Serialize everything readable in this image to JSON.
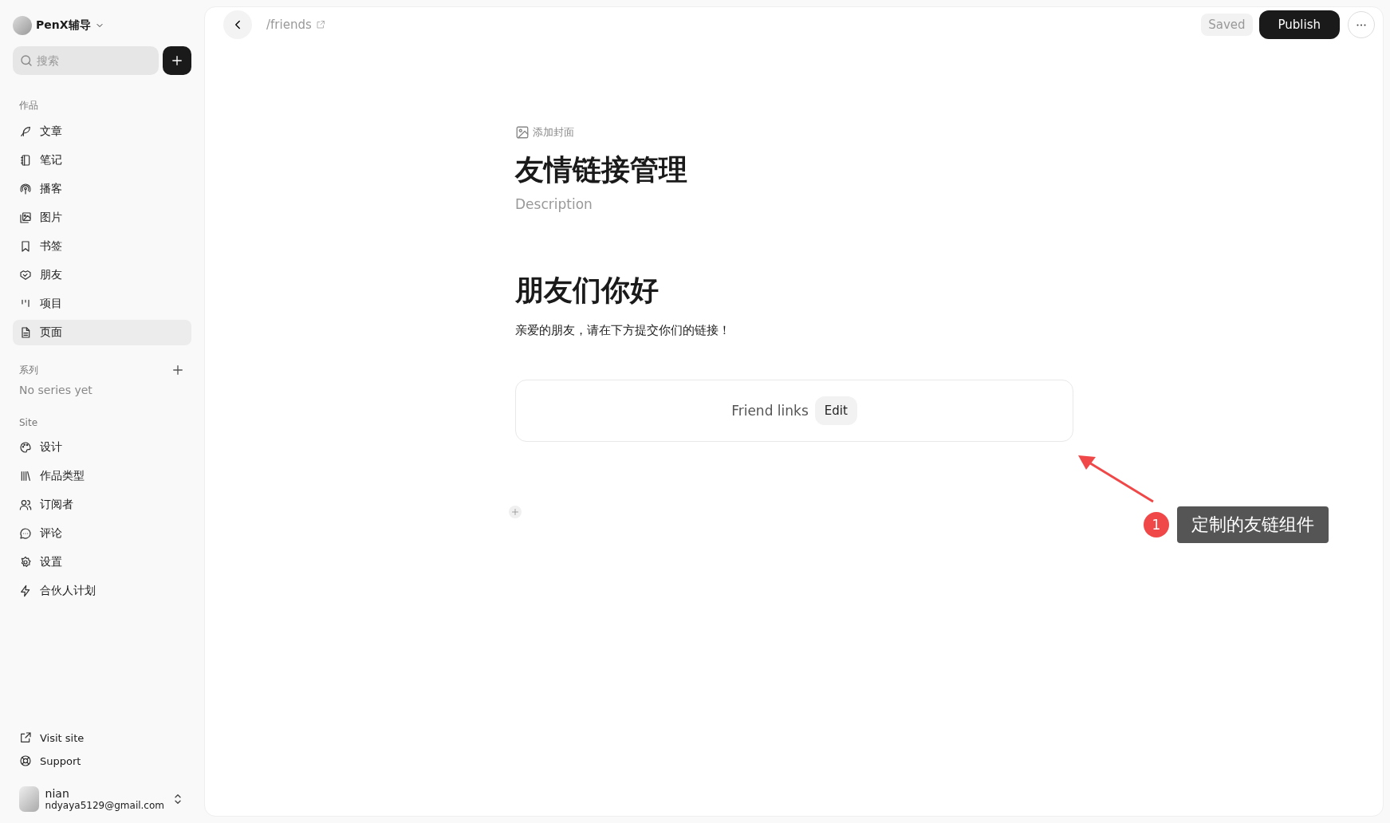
{
  "workspace": {
    "name": "PenX辅导"
  },
  "search": {
    "placeholder": "搜索"
  },
  "works_section": {
    "heading": "作品",
    "items": [
      {
        "label": "文章",
        "selected": false
      },
      {
        "label": "笔记",
        "selected": false
      },
      {
        "label": "播客",
        "selected": false
      },
      {
        "label": "图片",
        "selected": false
      },
      {
        "label": "书签",
        "selected": false
      },
      {
        "label": "朋友",
        "selected": false
      },
      {
        "label": "项目",
        "selected": false
      },
      {
        "label": "页面",
        "selected": true
      }
    ]
  },
  "series_section": {
    "heading": "系列",
    "empty_text": "No series yet"
  },
  "site_section": {
    "heading": "Site",
    "items": [
      {
        "label": "设计",
        "selected": false
      },
      {
        "label": "作品类型",
        "selected": false
      },
      {
        "label": "订阅者",
        "selected": false
      },
      {
        "label": "评论",
        "selected": false
      },
      {
        "label": "设置",
        "selected": false
      },
      {
        "label": "合伙人计划",
        "selected": false
      }
    ]
  },
  "footer_links": [
    {
      "label": "Visit site"
    },
    {
      "label": "Support"
    }
  ],
  "user": {
    "name": "nian",
    "email": "ndyaya5129@gmail.com"
  },
  "toolbar": {
    "path": "/friends",
    "status": "Saved",
    "publish": "Publish"
  },
  "editor": {
    "add_cover": "添加封面",
    "title": "友情链接管理",
    "description_placeholder": "Description",
    "heading": "朋友们你好",
    "paragraph": "亲爱的朋友，请在下方提交你们的链接！",
    "widget": {
      "label": "Friend links",
      "button": "Edit"
    }
  },
  "annotation": {
    "number": "1",
    "text": "定制的友链组件"
  }
}
